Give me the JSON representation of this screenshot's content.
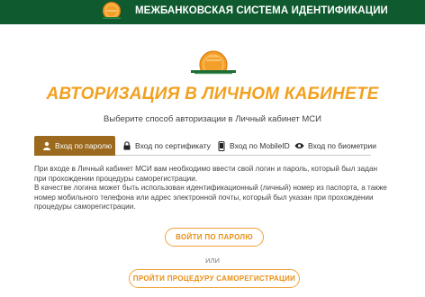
{
  "header": {
    "title": "МЕЖБАНКОВСКАЯ СИСТЕМА ИДЕНТИФИКАЦИИ",
    "logo_icon": "coin-sunrise-logo-icon"
  },
  "main": {
    "logo_icon": "coin-sunrise-logo-icon",
    "title": "АВТОРИЗАЦИЯ В ЛИЧНОМ КАБИНЕТЕ",
    "subtitle": "Выберите способ авторизации в Личный кабинет МСИ",
    "tabs": [
      {
        "label": "Вход по паролю",
        "icon": "user-icon",
        "active": true
      },
      {
        "label": "Вход по сертификату",
        "icon": "lock-icon",
        "active": false
      },
      {
        "label": "Вход по MobileID",
        "icon": "phone-icon",
        "active": false
      },
      {
        "label": "Вход по биометрии",
        "icon": "eye-icon",
        "active": false
      }
    ],
    "description": [
      "При входе в Личный кабинет МСИ вам необходимо ввести свой логин и пароль, который был задан при прохождении процедуры саморегистрации.",
      "В качестве логина может быть использован идентификационный (личный) номер из паспорта, а также номер мобильного телефона или адрес электронной почты, который был указан при прохождении процедуры саморегистрации."
    ],
    "login_button": "ВОЙТИ ПО ПАРОЛЮ",
    "or_text": "ИЛИ",
    "register_button": "ПРОЙТИ ПРОЦЕДУРУ САМОРЕГИСТРАЦИИ"
  },
  "colors": {
    "header_bg": "#0f5a2f",
    "accent_orange": "#f2a01f",
    "tab_active_bg": "#9b6a1e"
  }
}
